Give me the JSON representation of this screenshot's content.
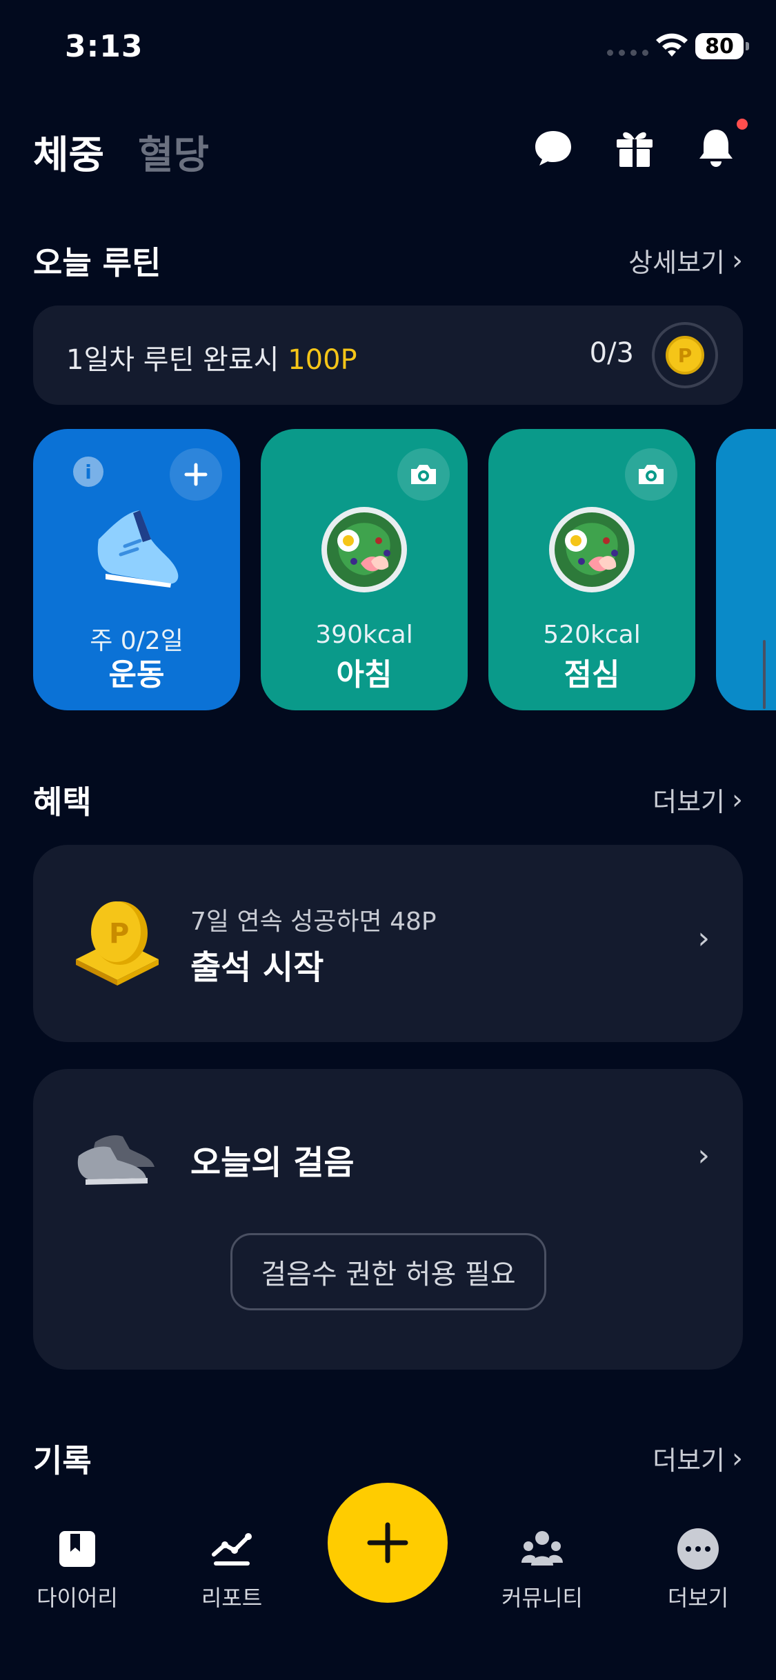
{
  "status_bar": {
    "time": "3:13",
    "battery": "80"
  },
  "header": {
    "tabs": [
      {
        "label": "체중"
      },
      {
        "label": "혈당"
      }
    ],
    "icons": [
      "chat-icon",
      "gift-icon",
      "bell-icon"
    ]
  },
  "today_routine": {
    "title": "오늘 루틴",
    "detail_link": "상세보기",
    "reward_text": "1일차 루틴 완료시 ",
    "reward_points": "100P",
    "progress": "0/3",
    "coin_symbol": "P"
  },
  "routine_cards": [
    {
      "subtitle": "주 0/2일",
      "title": "운동",
      "icon": "shoe-icon"
    },
    {
      "subtitle": "390kcal",
      "title": "아침",
      "icon": "salad-icon"
    },
    {
      "subtitle": "520kcal",
      "title": "점심",
      "icon": "salad-icon"
    }
  ],
  "benefits": {
    "title": "혜택",
    "more_link": "더보기",
    "attendance": {
      "subtitle": "7일 연속 성공하면 48P",
      "title": "출석 시작",
      "icon": "coin-pedestal-icon"
    },
    "steps": {
      "title": "오늘의 걸음",
      "permission_button": "걸음수 권한 허용 필요",
      "icon": "sneakers-icon"
    }
  },
  "records": {
    "title": "기록",
    "more_link": "더보기"
  },
  "bottom_nav": [
    {
      "label": "다이어리",
      "icon": "diary-icon"
    },
    {
      "label": "리포트",
      "icon": "report-icon"
    },
    {
      "label": "커뮤니티",
      "icon": "community-icon"
    },
    {
      "label": "더보기",
      "icon": "more-icon"
    }
  ],
  "colors": {
    "background": "#020a1e",
    "card": "#141b2e",
    "accent": "#ffcc00",
    "exercise": "#0b72d6",
    "meal": "#0a9a8a"
  }
}
